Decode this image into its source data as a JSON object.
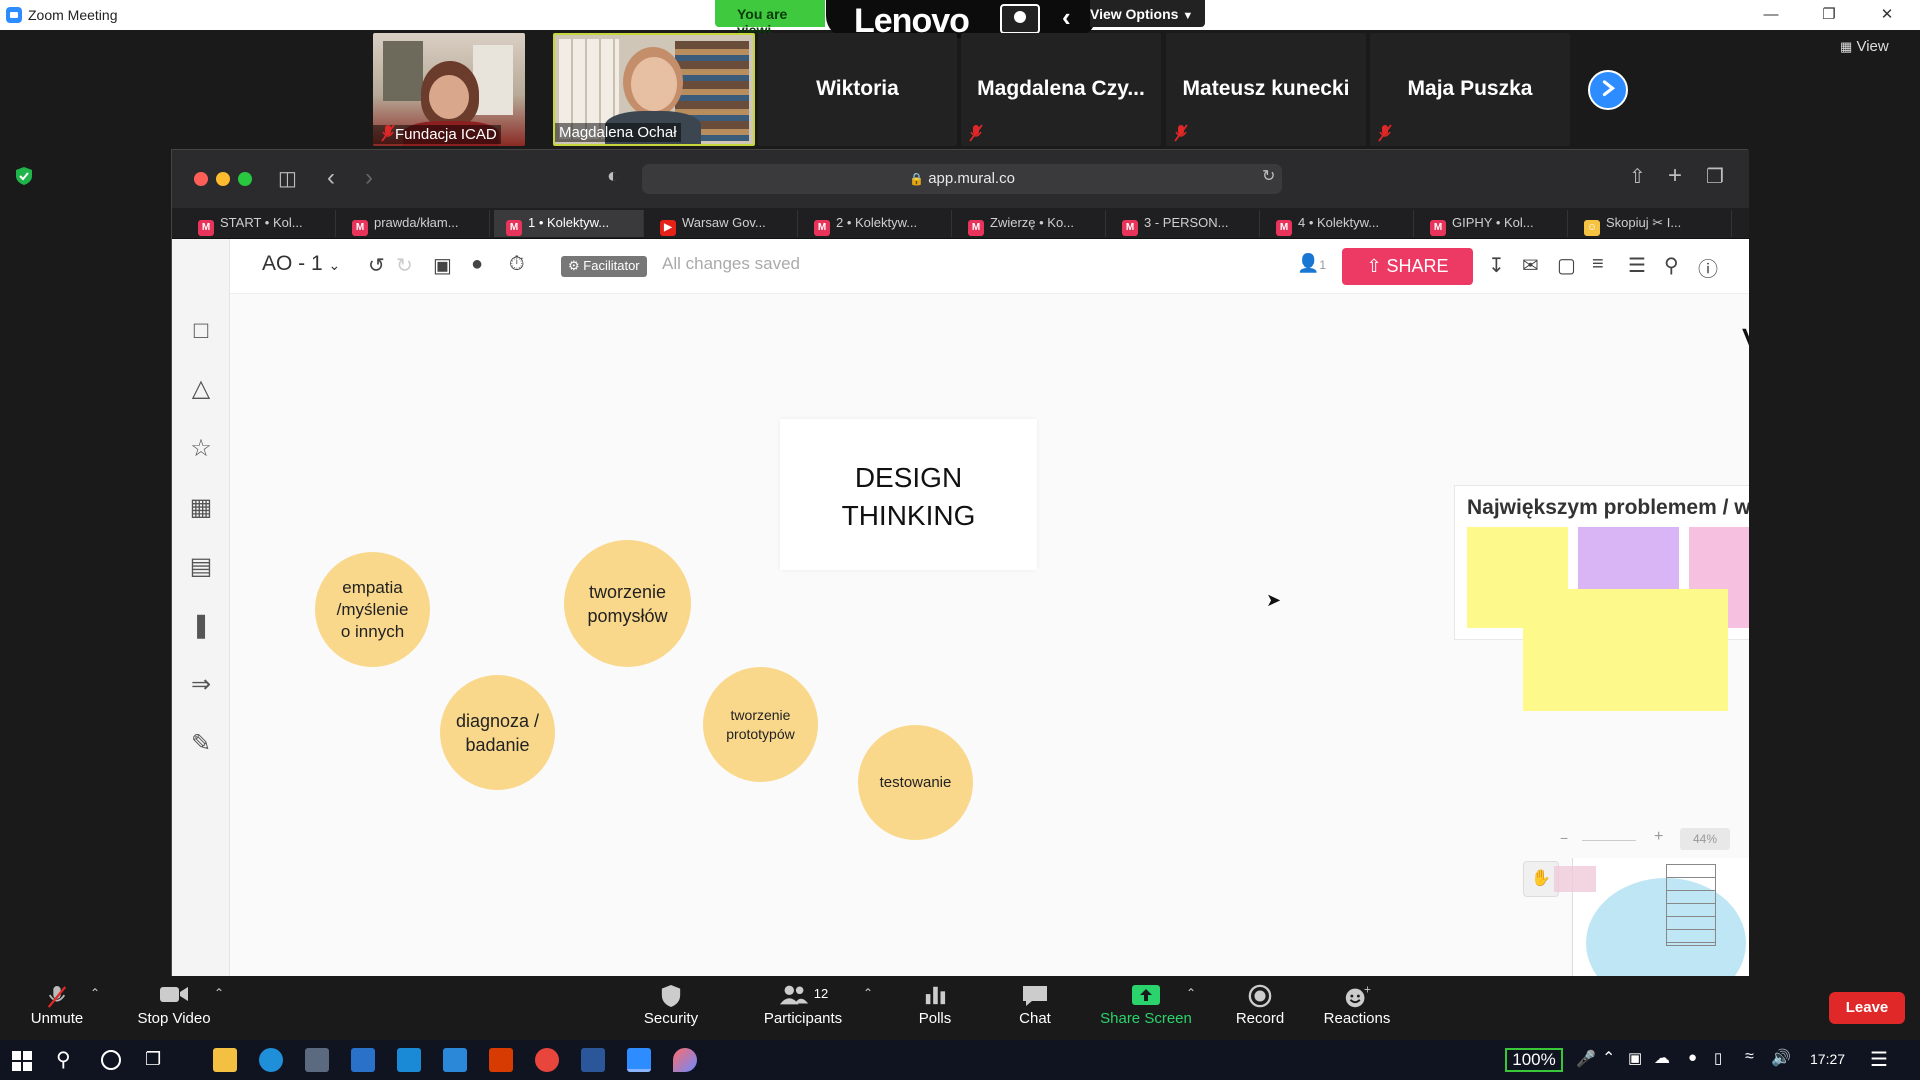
{
  "zoom_window": {
    "title": "Zoom Meeting",
    "viewing_banner": "You are viewi",
    "lenovo_logo": "Lenovo",
    "view_options": "View Options",
    "view_button": "View"
  },
  "participants": [
    {
      "name": "Fundacja ICAD",
      "type": "video",
      "muted": true
    },
    {
      "name": "Magdalena Ochał",
      "type": "video",
      "muted": true
    },
    {
      "name": "Wiktoria",
      "type": "name",
      "muted": false
    },
    {
      "name": "Magdalena  Czy...",
      "type": "name",
      "muted": true
    },
    {
      "name": "Mateusz kunecki",
      "type": "name",
      "muted": true
    },
    {
      "name": "Maja Puszka",
      "type": "name",
      "muted": true
    }
  ],
  "browser": {
    "url": "app.mural.co",
    "tabs": [
      {
        "label": "START • Kol...",
        "favicon": "M",
        "active": false
      },
      {
        "label": "prawda/kłam...",
        "favicon": "M",
        "active": false
      },
      {
        "label": "1 • Kolektyw...",
        "favicon": "M",
        "active": true
      },
      {
        "label": "Warsaw Gov...",
        "favicon": "yt",
        "active": false
      },
      {
        "label": "2 • Kolektyw...",
        "favicon": "M",
        "active": false
      },
      {
        "label": "Zwierzę • Ko...",
        "favicon": "M",
        "active": false
      },
      {
        "label": "3 - PERSON...",
        "favicon": "M",
        "active": false
      },
      {
        "label": "4 • Kolektyw...",
        "favicon": "M",
        "active": false
      },
      {
        "label": "GIPHY • Kol...",
        "favicon": "M",
        "active": false
      },
      {
        "label": "Skopiuj ✂ I...",
        "favicon": "emoji",
        "active": false
      }
    ]
  },
  "mural": {
    "board_name": "AO - 1",
    "facilitator_badge": "Facilitator",
    "save_status": "All changes saved",
    "collaborators_count": "1",
    "share_label": "SHARE",
    "canvas": {
      "title_card": {
        "line1": "DESIGN",
        "line2": "THINKING"
      },
      "circles": [
        {
          "text": "empatia /myślenie o innych"
        },
        {
          "text": "tworzenie pomysłów"
        },
        {
          "text": "diagnoza / badanie"
        },
        {
          "text": "tworzenie prototypów"
        },
        {
          "text": "testowanie"
        }
      ],
      "problem_card_title": "Największym problemem / w",
      "partial_letter": "V",
      "zoom_level": "44%",
      "colors": {
        "circle": "#fad88b",
        "sticky_yellow": "#fdf98a",
        "sticky_purple": "#d9b5f5",
        "sticky_pink": "#f6c1e0",
        "share": "#ec3a64"
      }
    }
  },
  "bottom_toolbar": {
    "unmute": "Unmute",
    "stop_video": "Stop Video",
    "security": "Security",
    "participants": "Participants",
    "participants_count": "12",
    "polls": "Polls",
    "chat": "Chat",
    "share_screen": "Share Screen",
    "record": "Record",
    "reactions": "Reactions",
    "leave": "Leave"
  },
  "taskbar": {
    "zoom_percent": "100%",
    "time": "17:27"
  }
}
